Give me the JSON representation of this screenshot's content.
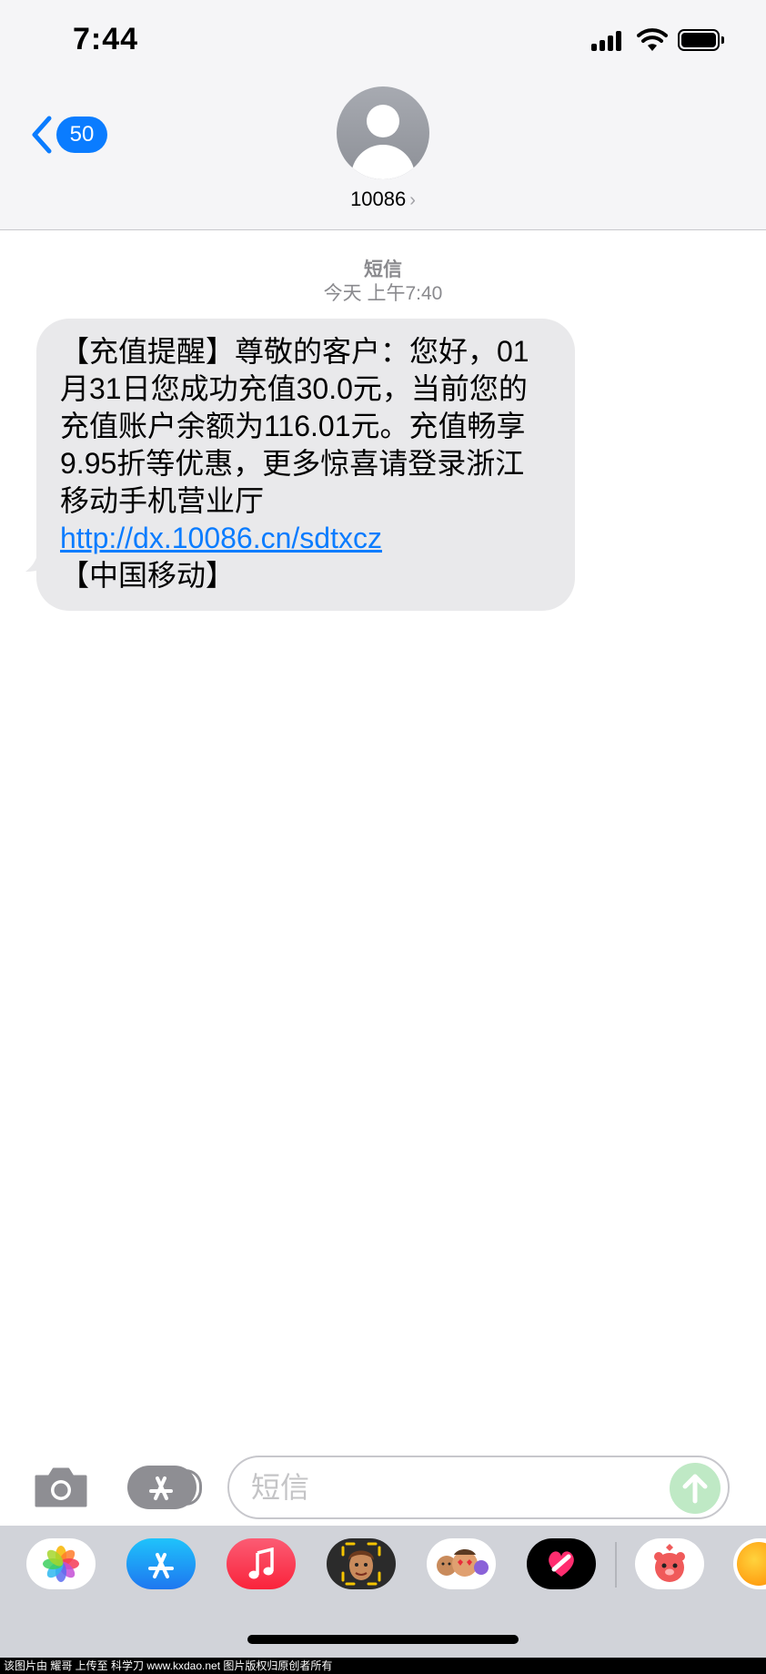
{
  "status_bar": {
    "time": "7:44"
  },
  "nav": {
    "back_badge": "50",
    "contact_name": "10086",
    "contact_chevron": "›"
  },
  "conversation": {
    "service_label": "短信",
    "timestamp": "今天 上午7:40",
    "message": {
      "text_before_link": "【充值提醒】尊敬的客户：您好，01月31日您成功充值30.0元，当前您的充值账户余额为116.01元。充值畅享9.95折等优惠，更多惊喜请登录浙江移动手机营业厅 ",
      "link_text": "http://dx.10086.cn/sdtxcz",
      "text_after_link": " 【中国移动】"
    }
  },
  "composer": {
    "placeholder": "短信",
    "value": ""
  },
  "app_tray": {
    "apps": [
      "photos-icon",
      "app-store-icon",
      "music-icon",
      "memoji-icon",
      "animoji-stickers-icon",
      "heart-digital-touch-icon",
      "pink-monster-app-icon",
      "weibo-app-icon"
    ]
  },
  "watermark": "该图片由 耀哥 上传至 科学刀 www.kxdao.net 图片版权归原创者所有",
  "colors": {
    "accent": "#0a7cff",
    "bubble_incoming": "#e9e9eb",
    "header_bg": "#f5f5f7",
    "send_disabled": "#bfe9c5",
    "tray_bg": "#d1d3d9"
  }
}
